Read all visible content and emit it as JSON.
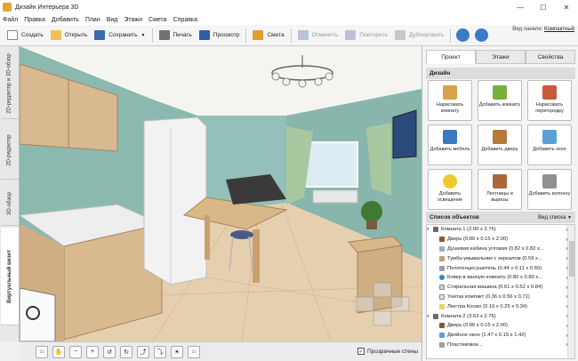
{
  "window": {
    "title": "Дизайн Интерьера 3D",
    "minimize": "—",
    "maximize": "☐",
    "close": "✕"
  },
  "menu": [
    "Файл",
    "Правка",
    "Добавить",
    "План",
    "Вид",
    "Этажи",
    "Смета",
    "Справка"
  ],
  "toolbar": {
    "create": "Создать",
    "open": "Открыть",
    "save": "Сохранить",
    "save_arrow": "▼",
    "print": "Печать",
    "preview": "Просмотр",
    "estimate": "Смета",
    "undo": "Отменить",
    "redo": "Повторить",
    "duplicate": "Дублировать",
    "panel_view_label": "Вид панели:",
    "panel_view_value": "Компактный"
  },
  "left_tabs": [
    "2D-редактор и 3D-обзор",
    "2D-редактор",
    "3D-обзор",
    "Виртуальный визит"
  ],
  "left_tab_active": 3,
  "bottom": {
    "transparent_walls": "Прозрачные стены",
    "transparent_checked": "✓"
  },
  "right_tabs": [
    "Проект",
    "Этажи",
    "Свойства"
  ],
  "design": {
    "header": "Дизайн",
    "buttons": [
      {
        "label": "Нарисовать комнату",
        "color": "#d6a24a"
      },
      {
        "label": "Добавить комнату",
        "color": "#78b03c"
      },
      {
        "label": "Нарисовать перегородку",
        "color": "#c85a3c"
      },
      {
        "label": "Добавить мебель",
        "color": "#3b78c2"
      },
      {
        "label": "Добавить дверь",
        "color": "#b8783c"
      },
      {
        "label": "Добавить окно",
        "color": "#5aa0d8"
      },
      {
        "label": "Добавить освещение",
        "color": "#f0c830"
      },
      {
        "label": "Лестницы и вырезы",
        "color": "#a8683c"
      },
      {
        "label": "Добавить колонну",
        "color": "#909090"
      }
    ]
  },
  "objects": {
    "header": "Список объектов",
    "view_list": "Вид списка",
    "view_arrow": "▼",
    "items": [
      {
        "text": "Комната 1  (2.00 x 2.76)",
        "level": 0,
        "color": "#6a6a6a",
        "expanded": true
      },
      {
        "text": "Дверь  (0.80 x 0.15 x 2.00)",
        "level": 1,
        "color": "#8a5a30"
      },
      {
        "text": "Душевая кабина угловая  (0.82 x 0.82 x...",
        "level": 1,
        "color": "#9ab0c0"
      },
      {
        "text": "Тумба-умывальник с зеркалом  (0.59 x...",
        "level": 1,
        "color": "#c0a070"
      },
      {
        "text": "Полотенцесушитель  (0.44 x 0.11 x 0.65)",
        "level": 1,
        "color": "#a0a0a0"
      },
      {
        "text": "Ковер в ванную комнату  (0.80 x 0.80 x...",
        "level": 1,
        "color": "#3a80c0"
      },
      {
        "text": "Стиральная машина  (0.61 x 0.52 x 0.84)",
        "level": 1,
        "color": "#d0d0d0"
      },
      {
        "text": "Унитаз компакт  (0.36 x 0.56 x 0.71)",
        "level": 1,
        "color": "#e0e0e0"
      },
      {
        "text": "Люстра Космо  (0.16 x 0.25 x 0.34)",
        "level": 1,
        "color": "#f0d060"
      },
      {
        "text": "Комната 2  (3.63 x 2.76)",
        "level": 0,
        "color": "#6a6a6a",
        "expanded": true
      },
      {
        "text": "Дверь  (0.80 x 0.15 x 2.00)",
        "level": 1,
        "color": "#8a5a30"
      },
      {
        "text": "Двойное окно  (1.47 x 0.15 x 1.42)",
        "level": 1,
        "color": "#5aa0d8"
      },
      {
        "text": "Пластиковое...",
        "level": 1,
        "color": "#a0a0a0"
      }
    ]
  },
  "colors": {
    "accent": "#2c6fb8",
    "wall": "#7fb0a8",
    "cabinet": "#d4b48a"
  }
}
